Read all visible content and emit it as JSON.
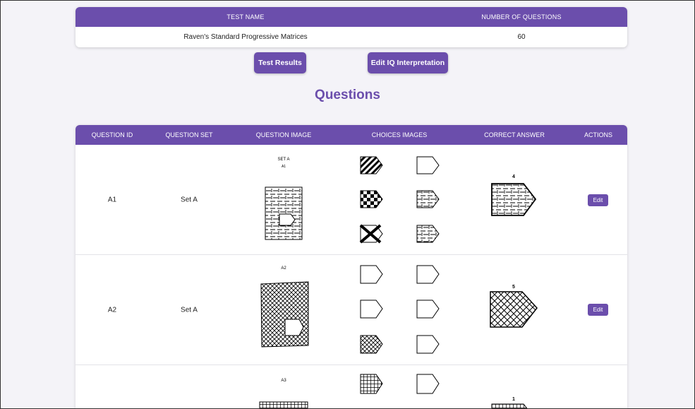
{
  "test_table": {
    "headers": [
      "TEST NAME",
      "NUMBER OF QUESTIONS"
    ],
    "row": {
      "name": "Raven's Standard Progressive Matrices",
      "count": "60"
    }
  },
  "buttons": {
    "results": "Test Results",
    "interpretation": "Edit IQ Interpretation"
  },
  "section_title": "Questions",
  "questions_table": {
    "headers": [
      "QUESTION ID",
      "QUESTION SET",
      "QUESTION IMAGE",
      "CHOICES IMAGES",
      "CORRECT ANSWER",
      "ACTIONS"
    ],
    "rows": [
      {
        "id": "A1",
        "set": "Set A",
        "image_caption": "SET A",
        "image_sub": "A1",
        "answer_num": "4",
        "action": "Edit"
      },
      {
        "id": "A2",
        "set": "Set A",
        "image_caption": "A2",
        "answer_num": "5",
        "action": "Edit"
      },
      {
        "id": "",
        "set": "",
        "image_caption": "A3",
        "answer_num": "1",
        "action": ""
      }
    ]
  },
  "colors": {
    "accent": "#6b4eac",
    "background": "#f4f3f8"
  }
}
